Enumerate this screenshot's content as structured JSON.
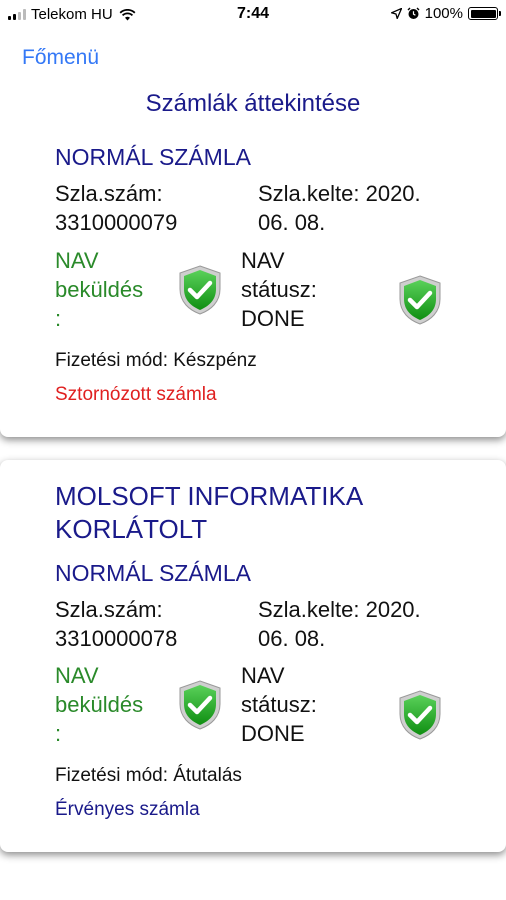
{
  "status_bar": {
    "carrier": "Telekom HU",
    "time": "7:44",
    "battery": "100%"
  },
  "nav": {
    "back_label": "Főmenü"
  },
  "page_title": "Számlák áttekintése",
  "invoices": [
    {
      "type": "NORMÁL SZÁMLA",
      "number_label": "Szla.szám:",
      "number": "3310000079",
      "date_label": "Szla.kelte: 2020.",
      "date": "06. 08.",
      "nav_send_line1": "NAV",
      "nav_send_line2": "beküldés",
      "nav_send_line3": ":",
      "nav_status_line1": "NAV",
      "nav_status_line2": "státusz:",
      "nav_status_line3": "DONE",
      "payment": "Fizetési mód: Készpénz",
      "state": "Sztornózott számla",
      "state_color": "#e02020"
    },
    {
      "company_line1": "MOLSOFT INFORMATIKA",
      "company_line2": "KORLÁTOLT",
      "type": "NORMÁL SZÁMLA",
      "number_label": "Szla.szám:",
      "number": "3310000078",
      "date_label": "Szla.kelte: 2020.",
      "date": "06. 08.",
      "nav_send_line1": "NAV",
      "nav_send_line2": "beküldés",
      "nav_send_line3": ":",
      "nav_status_line1": "NAV",
      "nav_status_line2": "státusz:",
      "nav_status_line3": "DONE",
      "payment": "Fizetési mód: Átutalás",
      "state": "Érvényes számla",
      "state_color": "#1a1a8a"
    }
  ],
  "colors": {
    "ios_blue": "#3478f6",
    "heading_navy": "#1a1a8a",
    "nav_green": "#2a8a2a",
    "shield_green": "#1fb21f"
  },
  "icons": [
    "signal-icon",
    "wifi-icon",
    "location-icon",
    "alarm-icon",
    "battery-icon",
    "shield-check-icon"
  ]
}
